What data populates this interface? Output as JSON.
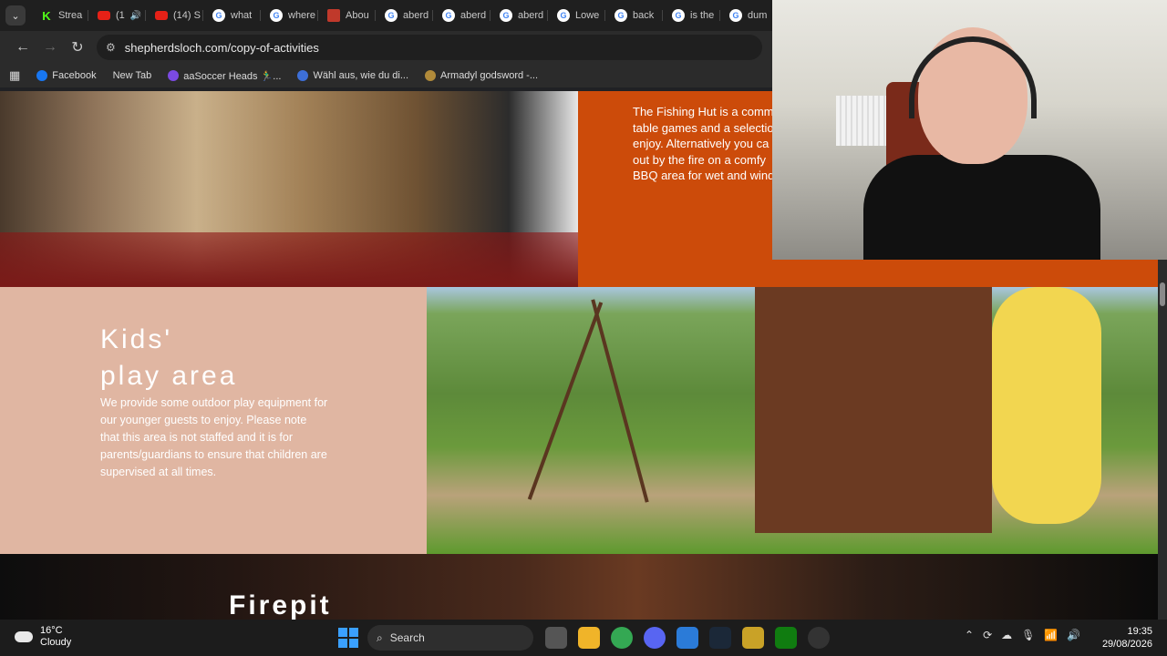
{
  "browser": {
    "tabs": [
      {
        "label": "Strea",
        "icon": "kick-icon"
      },
      {
        "label": "(1",
        "icon": "youtube-icon"
      },
      {
        "label": "(14) S",
        "icon": "youtube-icon"
      },
      {
        "label": "what",
        "icon": "google-icon"
      },
      {
        "label": "where",
        "icon": "google-icon"
      },
      {
        "label": "Abou",
        "icon": "site-icon"
      },
      {
        "label": "aberd",
        "icon": "google-icon"
      },
      {
        "label": "aberd",
        "icon": "google-icon"
      },
      {
        "label": "aberd",
        "icon": "google-icon"
      },
      {
        "label": "Lowe",
        "icon": "google-icon"
      },
      {
        "label": "back",
        "icon": "google-icon"
      },
      {
        "label": "is the",
        "icon": "google-icon"
      },
      {
        "label": "dum",
        "icon": "google-icon"
      }
    ],
    "url": "shepherdsloch.com/copy-of-activities",
    "bookmarks": [
      {
        "label": "Facebook"
      },
      {
        "label": "New Tab"
      },
      {
        "label": "aaSoccer Heads 🏃‍♂️..."
      },
      {
        "label": "Wähl aus, wie du di..."
      },
      {
        "label": "Armadyl godsword -..."
      }
    ]
  },
  "page": {
    "fishing_hut_text": "The Fishing Hut is a comm\ntable games and a selectio\nenjoy.  Alternatively you ca\nout by the fire on a comfy\nBBQ area for wet and wind",
    "kids_title": "Kids'\nplay area",
    "kids_body": "We provide some outdoor play equipment for our younger guests to enjoy.  Please note that this area is not staffed and it is for parents/guardians to ensure that children are supervised at all times.",
    "firepit_title": "Firepit"
  },
  "taskbar": {
    "temperature": "16°C",
    "weather": "Cloudy",
    "search_label": "Search",
    "time": "19:35",
    "date": "29/08/2026"
  },
  "colors": {
    "orange_panel": "#cc4b0a",
    "pink_panel": "#e0b6a2"
  }
}
